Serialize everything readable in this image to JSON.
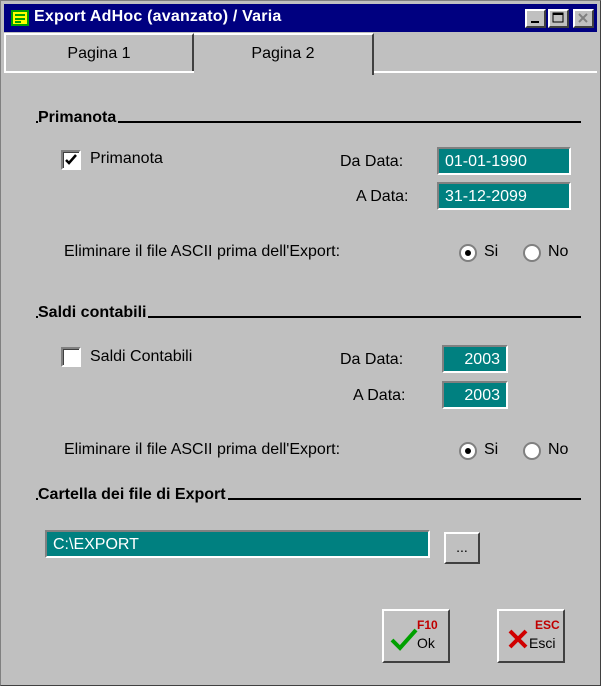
{
  "window": {
    "title": "Export AdHoc (avanzato) / Varia"
  },
  "tabs": [
    {
      "label": "Pagina 1"
    },
    {
      "label": "Pagina 2"
    }
  ],
  "primanota": {
    "section_title": "Primanota",
    "checkbox_label": "Primanota",
    "checked": true,
    "da_data_label": "Da Data:",
    "da_data_value": "01-01-1990",
    "a_data_label": "A Data:",
    "a_data_value": "31-12-2099",
    "delete_question": "Eliminare il file ASCII prima dell'Export:",
    "option_si": "Si",
    "option_no": "No",
    "selected": "Si"
  },
  "saldi": {
    "section_title": "Saldi contabili",
    "checkbox_label": "Saldi Contabili",
    "checked": false,
    "da_data_label": "Da Data:",
    "da_data_value": "2003",
    "a_data_label": "A Data:",
    "a_data_value": "2003",
    "delete_question": "Eliminare il file ASCII prima dell'Export:",
    "option_si": "Si",
    "option_no": "No",
    "selected": "Si"
  },
  "cartella": {
    "section_title": "Cartella dei file di Export",
    "path": "C:\\EXPORT",
    "browse_label": "..."
  },
  "buttons": {
    "ok_hotkey": "F10",
    "ok_label": "Ok",
    "esci_hotkey": "ESC",
    "esci_label": "Esci"
  },
  "colors": {
    "titlebar": "#000080",
    "field": "#008080",
    "face": "#c0c0c0"
  }
}
